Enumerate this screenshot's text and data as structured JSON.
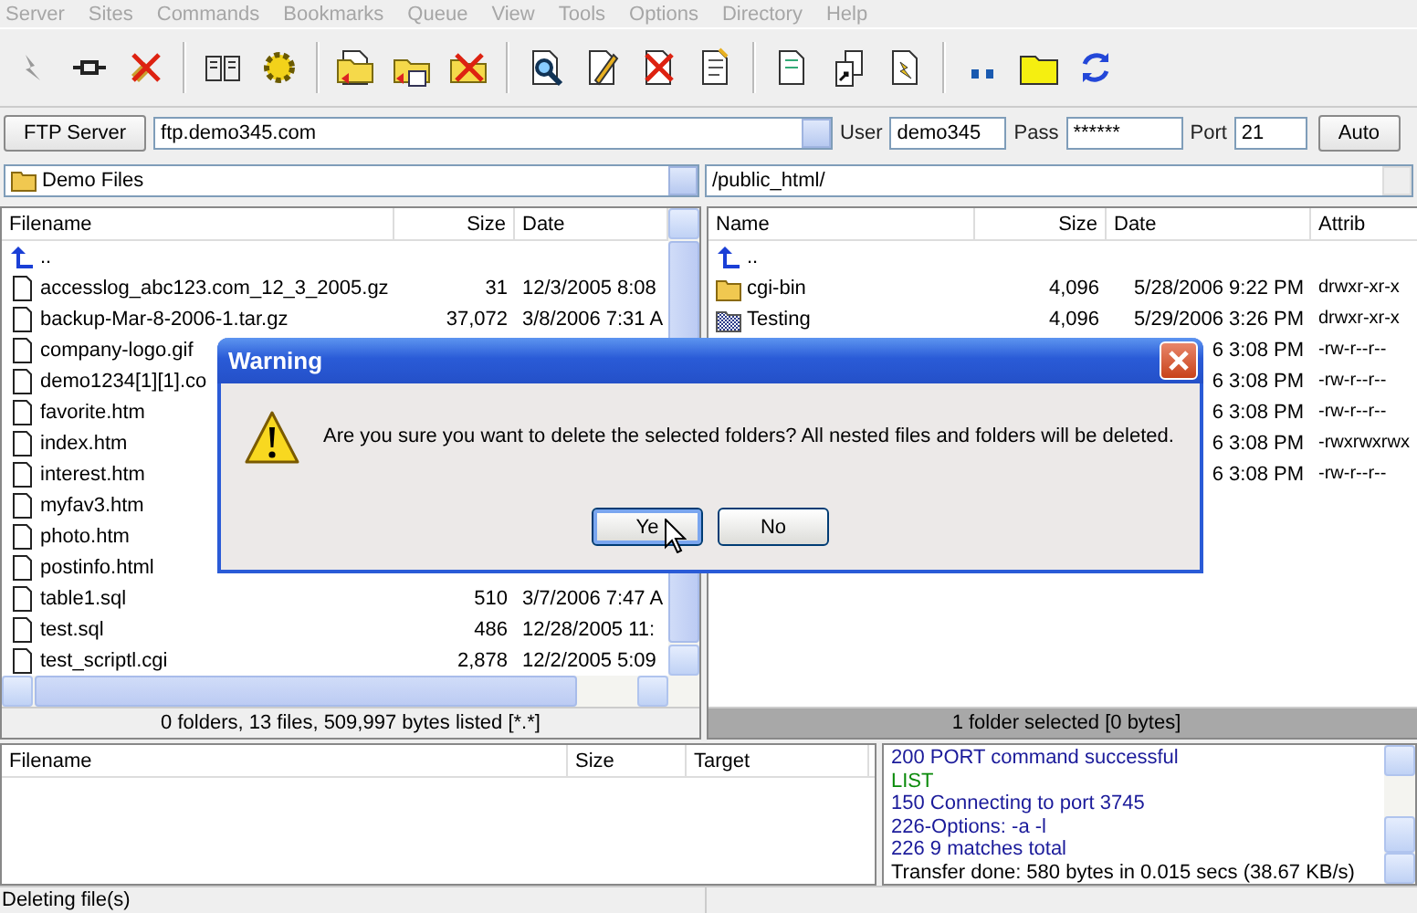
{
  "menu": [
    {
      "label": "Server",
      "disabled": true
    },
    {
      "label": "Sites",
      "disabled": true
    },
    {
      "label": "Commands",
      "disabled": true
    },
    {
      "label": "Bookmarks",
      "disabled": true
    },
    {
      "label": "Queue",
      "disabled": true
    },
    {
      "label": "View",
      "disabled": true
    },
    {
      "label": "Tools",
      "disabled": true
    },
    {
      "label": "Options",
      "disabled": true
    },
    {
      "label": "Directory",
      "disabled": true
    },
    {
      "label": "Help",
      "disabled": true
    }
  ],
  "connection": {
    "server_button": "FTP Server",
    "host": "ftp.demo345.com",
    "user_label": "User",
    "user": "demo345",
    "pass_label": "Pass",
    "pass": "******",
    "port_label": "Port",
    "port": "21",
    "auto_button": "Auto"
  },
  "local_path": "Demo Files",
  "remote_path": "/public_html/",
  "local": {
    "columns": [
      "Filename",
      "Size",
      "Date"
    ],
    "rows": [
      {
        "kind": "parent",
        "name": ".."
      },
      {
        "kind": "file",
        "name": "accesslog_abc123.com_12_3_2005.gz",
        "size": "31",
        "date": "12/3/2005 8:08"
      },
      {
        "kind": "file",
        "name": "backup-Mar-8-2006-1.tar.gz",
        "size": "37,072",
        "date": "3/8/2006 7:31 A"
      },
      {
        "kind": "file",
        "name": "company-logo.gif"
      },
      {
        "kind": "file",
        "name": "demo1234[1][1].co"
      },
      {
        "kind": "file",
        "name": "favorite.htm"
      },
      {
        "kind": "file",
        "name": "index.htm"
      },
      {
        "kind": "file",
        "name": "interest.htm"
      },
      {
        "kind": "file",
        "name": "myfav3.htm"
      },
      {
        "kind": "file",
        "name": "photo.htm"
      },
      {
        "kind": "file",
        "name": "postinfo.html"
      },
      {
        "kind": "file",
        "name": "table1.sql",
        "size": "510",
        "date": "3/7/2006 7:47 A"
      },
      {
        "kind": "file",
        "name": "test.sql",
        "size": "486",
        "date": "12/28/2005 11:"
      },
      {
        "kind": "file",
        "name": "test_scriptl.cgi",
        "size": "2,878",
        "date": "12/2/2005 5:09"
      }
    ],
    "status": "0 folders, 13 files, 509,997 bytes listed [*.*]"
  },
  "remote": {
    "columns": [
      "Name",
      "Size",
      "Date",
      "Attrib"
    ],
    "rows": [
      {
        "kind": "parent",
        "name": "..",
        "selected": false
      },
      {
        "kind": "folder",
        "name": "cgi-bin",
        "size": "4,096",
        "date": "5/28/2006 9:22 PM",
        "attrib": "drwxr-xr-x",
        "selected": false
      },
      {
        "kind": "folder",
        "name": "Testing",
        "size": "4,096",
        "date": "5/29/2006 3:26 PM",
        "attrib": "drwxr-xr-x",
        "selected": true
      },
      {
        "kind": "covered",
        "date": "6 3:08 PM",
        "attrib": "-rw-r--r--"
      },
      {
        "kind": "covered",
        "date": "6 3:08 PM",
        "attrib": "-rw-r--r--"
      },
      {
        "kind": "covered",
        "date": "6 3:08 PM",
        "attrib": "-rw-r--r--"
      },
      {
        "kind": "covered",
        "date": "6 3:08 PM",
        "attrib": "-rwxrwxrwx"
      },
      {
        "kind": "covered",
        "date": "6 3:08 PM",
        "attrib": "-rw-r--r--"
      }
    ],
    "status": "1 folder selected [0 bytes]"
  },
  "queue": {
    "columns": [
      "Filename",
      "Size",
      "Target"
    ]
  },
  "log": [
    {
      "kind": "reply",
      "text": "200 PORT command successful"
    },
    {
      "kind": "command",
      "text": "LIST"
    },
    {
      "kind": "reply",
      "text": "150 Connecting to port 3745"
    },
    {
      "kind": "reply",
      "text": "226-Options: -a -l"
    },
    {
      "kind": "reply",
      "text": "226 9 matches total"
    },
    {
      "kind": "status",
      "text": "Transfer done: 580 bytes in 0.015 secs (38.67 KB/s)"
    }
  ],
  "status_bar": "Deleting file(s)",
  "dialog": {
    "title": "Warning",
    "message": "Are you sure you want to delete the selected folders?  All nested files and folders will be deleted.",
    "buttons": [
      {
        "label": "Ye",
        "focused": true
      },
      {
        "label": "No",
        "focused": false
      }
    ]
  }
}
